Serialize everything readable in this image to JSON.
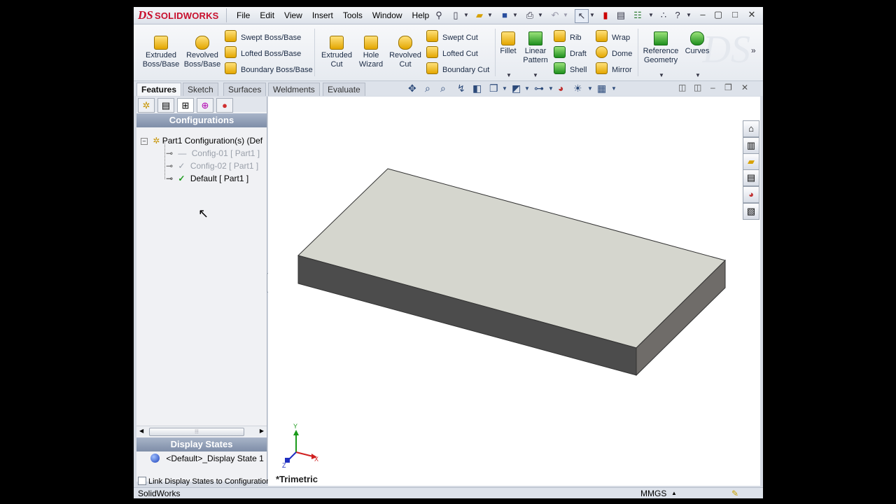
{
  "app": {
    "logo_ds": "DS",
    "logo_text": "SOLIDWORKS",
    "watermark": "DS"
  },
  "menu": {
    "items": [
      "File",
      "Edit",
      "View",
      "Insert",
      "Tools",
      "Window",
      "Help"
    ]
  },
  "ribbon": {
    "extruded_boss": "Extruded Boss/Base",
    "revolved_boss": "Revolved Boss/Base",
    "swept_boss": "Swept Boss/Base",
    "lofted_boss": "Lofted Boss/Base",
    "boundary_boss": "Boundary Boss/Base",
    "extruded_cut": "Extruded Cut",
    "hole_wizard": "Hole Wizard",
    "revolved_cut": "Revolved Cut",
    "swept_cut": "Swept Cut",
    "lofted_cut": "Lofted Cut",
    "boundary_cut": "Boundary Cut",
    "fillet": "Fillet",
    "linear_pattern": "Linear Pattern",
    "rib": "Rib",
    "draft": "Draft",
    "shell": "Shell",
    "wrap": "Wrap",
    "dome": "Dome",
    "mirror": "Mirror",
    "reference_geometry": "Reference Geometry",
    "curves": "Curves"
  },
  "tabs": [
    "Features",
    "Sketch",
    "Surfaces",
    "Weldments",
    "Evaluate"
  ],
  "panel": {
    "configurations_header": "Configurations",
    "root": "Part1 Configuration(s)  (Def",
    "configs": [
      {
        "label": "Config-01 [ Part1 ]"
      },
      {
        "label": "Config-02 [ Part1 ]"
      },
      {
        "label": "Default [ Part1 ]"
      }
    ],
    "display_states_header": "Display States",
    "display_state": "<Default>_Display State 1",
    "link_label": "Link Display States to Configuration"
  },
  "viewport": {
    "view_name": "*Trimetric",
    "triad": {
      "x": "X",
      "y": "Y",
      "z": "Z"
    }
  },
  "status": {
    "app_name": "SolidWorks",
    "units": "MMGS"
  },
  "colors": {
    "top_face": "#d5d6ce",
    "front_face": "#4c4c4c",
    "side_face": "#6f6c69",
    "brand_red": "#c8102e",
    "panel_header": "#8d9bb3"
  }
}
